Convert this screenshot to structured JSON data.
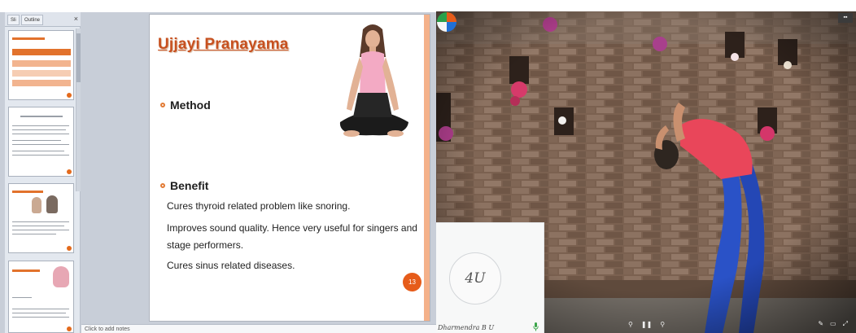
{
  "editor": {
    "panel_tabs": [
      "Sli",
      "Outline"
    ],
    "panel_close": "×",
    "notes_label": "Click to add notes"
  },
  "slide": {
    "title": "Ujjayi  Pranayama",
    "bullets": [
      {
        "label": "Method",
        "lines": []
      },
      {
        "label": "Benefit",
        "lines": [
          "Cures thyroid related problem like snoring.",
          "Improves sound quality. Hence very useful for singers and",
          "stage performers.",
          "Cures sinus related diseases."
        ]
      }
    ],
    "number": "13"
  },
  "video": {
    "controls": [
      "⚲",
      "❚❚",
      "⚲"
    ],
    "tools": [
      "✎",
      "▭",
      "⤢"
    ],
    "corner_label": "▪▪"
  },
  "participant": {
    "initials": "4U",
    "name": "Dharmendra B U"
  },
  "colors": {
    "accent_orange": "#e65c1a",
    "title_color": "#c7501f",
    "wall_dark": "#6d5546",
    "pants_blue": "#2a52c7",
    "top_pink": "#e9465a"
  }
}
